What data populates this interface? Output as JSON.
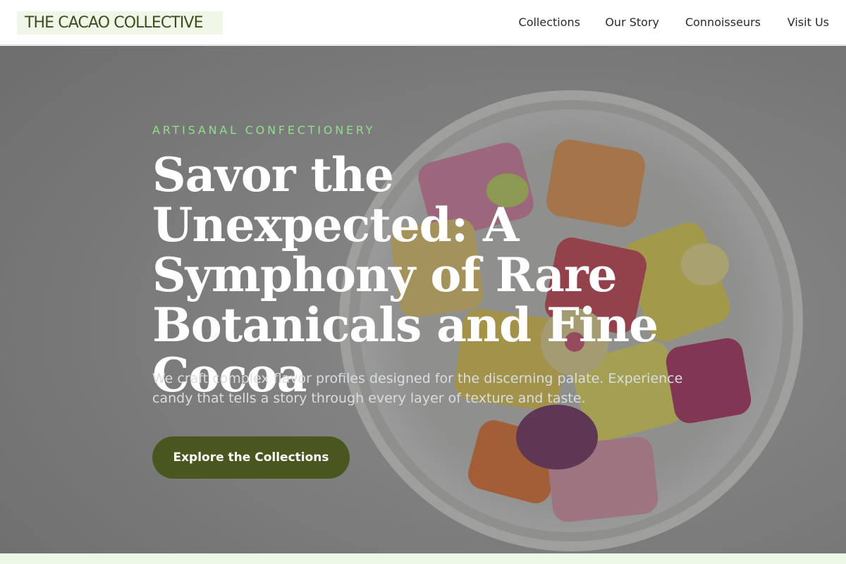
{
  "brand": {
    "name": "THE CACAO COLLECTIVE"
  },
  "nav": {
    "items": [
      {
        "label": "Collections"
      },
      {
        "label": "Our Story"
      },
      {
        "label": "Connoisseurs"
      },
      {
        "label": "Visit Us"
      }
    ]
  },
  "hero": {
    "eyebrow": "ARTISANAL CONFECTIONERY",
    "headline": "Savor the Unexpected: A Symphony of Rare Botanicals and Fine Cocoa",
    "subtext": "We craft complex flavor profiles designed for the discerning palate. Experience candy that tells a story through every layer of texture and taste.",
    "cta_label": "Explore the Collections",
    "image_subject": "glass jar of colorful hard candies"
  },
  "colors": {
    "brand_green": "#3f4d1e",
    "accent_green": "#8fe08a",
    "cta_bg": "#4a5620",
    "logo_bg": "#eff8e8"
  }
}
